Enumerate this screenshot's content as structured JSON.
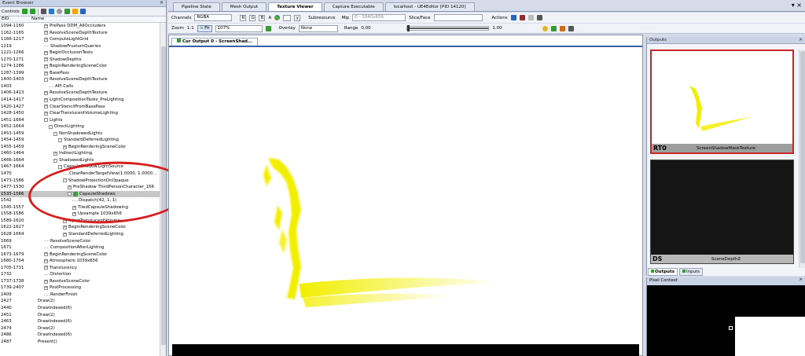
{
  "event_browser": {
    "title": "Event Browser",
    "controls_label": "Controls",
    "col_eid": "EID",
    "col_name": "Name",
    "rows": [
      {
        "eid": "1094-1160",
        "name": "PrePass DDM_AllOccluders",
        "d": 0,
        "exp": "+"
      },
      {
        "eid": "1162-1165",
        "name": "ResolveSceneDepthTexture",
        "d": 0,
        "exp": "+"
      },
      {
        "eid": "1166-1217",
        "name": "ComputeLightGrid",
        "d": 0,
        "exp": "+"
      },
      {
        "eid": "1219",
        "name": "ShadowFrustumQueries",
        "d": 0,
        "exp": ""
      },
      {
        "eid": "1221-1266",
        "name": "BeginOcclusionTests",
        "d": 0,
        "exp": "+"
      },
      {
        "eid": "1270-1271",
        "name": "ShadowDepths",
        "d": 0,
        "exp": "+"
      },
      {
        "eid": "1274-1286",
        "name": "BeginRenderingSceneColor",
        "d": 0,
        "exp": "+"
      },
      {
        "eid": "1287-1399",
        "name": "BasePass",
        "d": 0,
        "exp": "+"
      },
      {
        "eid": "1400-1403",
        "name": "ResolveSceneDepthTexture",
        "d": 0,
        "exp": "-"
      },
      {
        "eid": "1403",
        "name": "API Calls",
        "d": 1,
        "exp": ""
      },
      {
        "eid": "1406-1413",
        "name": "ResolveSceneDepthTexture",
        "d": 0,
        "exp": "+"
      },
      {
        "eid": "1414-1417",
        "name": "LightCompositionTasks_PreLighting",
        "d": 0,
        "exp": "+"
      },
      {
        "eid": "1420-1427",
        "name": "ClearStencilFromBasePass",
        "d": 0,
        "exp": "+"
      },
      {
        "eid": "1428-1450",
        "name": "ClearTranslucentVolumeLighting",
        "d": 0,
        "exp": "+"
      },
      {
        "eid": "1451-1664",
        "name": "Lights",
        "d": 0,
        "exp": "-"
      },
      {
        "eid": "1452-1664",
        "name": "DirectLighting",
        "d": 1,
        "exp": "-"
      },
      {
        "eid": "1453-1459",
        "name": "NonShadowedLights",
        "d": 2,
        "exp": "-"
      },
      {
        "eid": "1454-1459",
        "name": "StandardDeferredLighting",
        "d": 3,
        "exp": "-"
      },
      {
        "eid": "1455-1459",
        "name": "BeginRenderingSceneColor",
        "d": 4,
        "exp": "+"
      },
      {
        "eid": "1460-1464",
        "name": "IndirectLighting",
        "d": 2,
        "exp": "+"
      },
      {
        "eid": "1466-1664",
        "name": "ShadowedLights",
        "d": 2,
        "exp": "-"
      },
      {
        "eid": "1467-1664",
        "name": "CapsuleShadow.LightSource",
        "d": 3,
        "exp": "-"
      },
      {
        "eid": "1470",
        "name": "ClearRenderTargetView(1.0000, 1.0000...",
        "d": 4,
        "exp": ""
      },
      {
        "eid": "1473-1586",
        "name": "ShadowProjectionOnOpaque",
        "d": 4,
        "exp": "-"
      },
      {
        "eid": "1477-1530",
        "name": "PreShadow ThirdPersonCharacter_166",
        "d": 5,
        "exp": "+"
      },
      {
        "eid": "1535-1586",
        "name": "CapsuleShadows",
        "d": 5,
        "exp": "-",
        "sel": true
      },
      {
        "eid": "1542",
        "name": "Dispatch(42, 1, 1)",
        "d": 6,
        "exp": ""
      },
      {
        "eid": "1545-1557",
        "name": "TiledCapsuleShadowing",
        "d": 6,
        "exp": "+"
      },
      {
        "eid": "1558-1586",
        "name": "Upsample 1039x656",
        "d": 6,
        "exp": "+"
      },
      {
        "eid": "1589-1620",
        "name": "InjectTranslucentVolume",
        "d": 4,
        "exp": "+"
      },
      {
        "eid": "1622-1627",
        "name": "BeginRenderingSceneColor",
        "d": 4,
        "exp": "+"
      },
      {
        "eid": "1628-1664",
        "name": "StandardDeferredLighting",
        "d": 4,
        "exp": "+"
      },
      {
        "eid": "1669",
        "name": "ResolveSceneColor",
        "d": 0,
        "exp": ""
      },
      {
        "eid": "1671",
        "name": "CompositionAfterLighting",
        "d": 0,
        "exp": ""
      },
      {
        "eid": "1673-1679",
        "name": "BeginRenderingSceneColor",
        "d": 0,
        "exp": "+"
      },
      {
        "eid": "1680-1704",
        "name": "Atmosphere 1039x656",
        "d": 0,
        "exp": "+"
      },
      {
        "eid": "1705-1731",
        "name": "Translucency",
        "d": 0,
        "exp": "+"
      },
      {
        "eid": "1732",
        "name": "Distortion",
        "d": 0,
        "exp": ""
      },
      {
        "eid": "1737-1738",
        "name": "ResolveSceneColor",
        "d": 0,
        "exp": "+"
      },
      {
        "eid": "1739-2407",
        "name": "PostProcessing",
        "d": 0,
        "exp": "+"
      },
      {
        "eid": "2409",
        "name": "RenderFinish",
        "d": 0,
        "exp": ""
      },
      {
        "eid": "2427",
        "name": "Draw(2)",
        "d": -1,
        "exp": ""
      },
      {
        "eid": "2440",
        "name": "DrawIndexed(6)",
        "d": -1,
        "exp": ""
      },
      {
        "eid": "2451",
        "name": "Draw(2)",
        "d": -1,
        "exp": ""
      },
      {
        "eid": "2463",
        "name": "DrawIndexed(6)",
        "d": -1,
        "exp": ""
      },
      {
        "eid": "2474",
        "name": "Draw(2)",
        "d": -1,
        "exp": ""
      },
      {
        "eid": "2486",
        "name": "DrawIndexed(6)",
        "d": -1,
        "exp": ""
      },
      {
        "eid": "2487",
        "name": "Present()",
        "d": -1,
        "exp": ""
      }
    ]
  },
  "tabs": [
    "Pipeline State",
    "Mesh Output",
    "Texture Viewer",
    "Capture Executable",
    "localhost - UE4Editor [PID 14120]"
  ],
  "active_tab": "Texture Viewer",
  "toolbar": {
    "channels_label": "Channels",
    "channels_value": "RGBA",
    "ch_r": "R",
    "ch_g": "G",
    "ch_b": "B",
    "ch_a": "A",
    "ch_y": "y",
    "subresource_label": "Subresource",
    "mip_label": "Mip",
    "mip_value": "0 - 1040x656",
    "slice_label": "Slice/Face",
    "actions_label": "Actions",
    "zoom_label": "Zoom",
    "zoom_11": "1:1",
    "fit_label": "Fit",
    "zoom_value": "107%",
    "overlay_label": "Overlay",
    "overlay_value": "None",
    "range_label": "Range",
    "range_min": "0.00",
    "range_max": "1.00",
    "range_fill": 1.0
  },
  "viewer": {
    "doc_tab": "Cur Output 0 - ScreenShad..."
  },
  "outputs": {
    "title": "Outputs",
    "items": [
      {
        "slot": "RT0",
        "name": "ScreenShadowMaskTexture"
      },
      {
        "slot": "DS",
        "name": "SceneDepthZ"
      }
    ],
    "tab_outputs": "Outputs",
    "tab_inputs": "Inputs"
  },
  "pixel_context": {
    "title": "Pixel Context"
  },
  "colors": {
    "accent": "#3c5da8",
    "highlight_oval": "#d71f1f",
    "shadow_yellow": "#f2ee00"
  }
}
